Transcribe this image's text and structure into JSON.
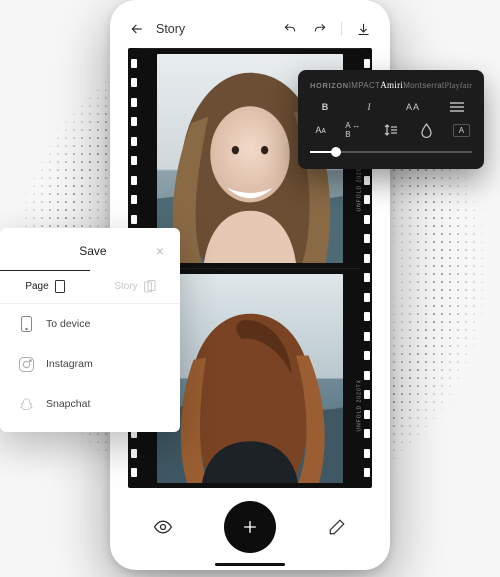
{
  "header": {
    "title": "Story"
  },
  "film": {
    "edge_label": "UNFOLD 2020TX"
  },
  "text_panel": {
    "fonts": [
      "HORIZON",
      "IMPACT",
      "Amiri",
      "Montserrat",
      "Playfair"
    ],
    "active_font_index": 2,
    "style_row": {
      "bold": "B",
      "italic": "I",
      "caps": "AA"
    },
    "opts_row": {
      "size": "Aᴀ",
      "spacing": "A ↔ B"
    }
  },
  "save_panel": {
    "title": "Save",
    "tabs": [
      {
        "label": "Page",
        "active": true
      },
      {
        "label": "Story",
        "active": false
      }
    ],
    "destinations": [
      {
        "label": "To device"
      },
      {
        "label": "Instagram"
      },
      {
        "label": "Snapchat"
      }
    ]
  }
}
